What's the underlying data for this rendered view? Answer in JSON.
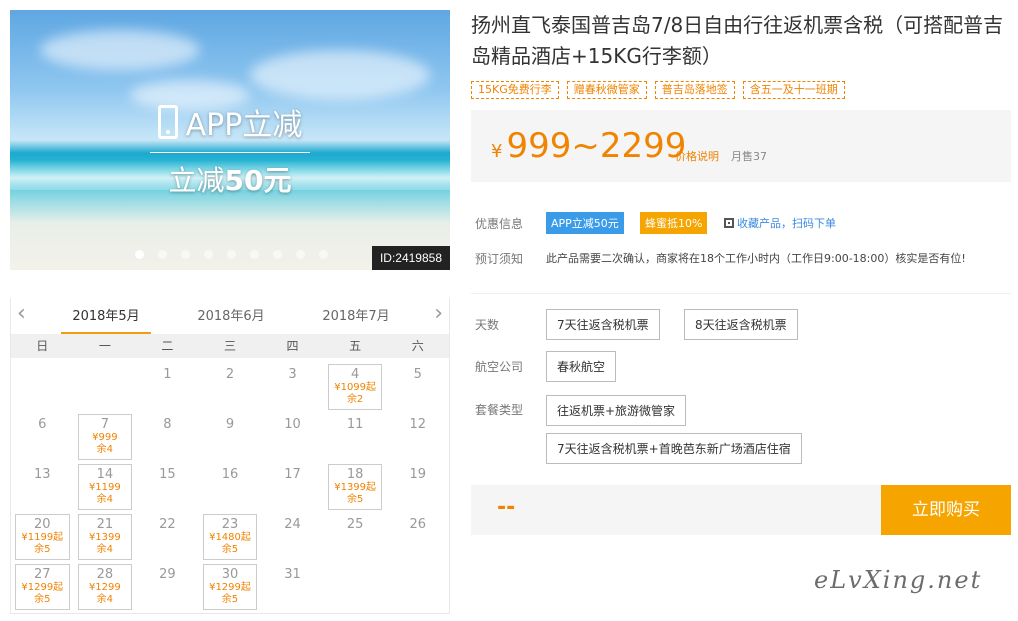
{
  "hero": {
    "promo_line1": "APP立减",
    "promo_line2_prefix": "立减",
    "promo_line2_amount": "50元",
    "image_id": "ID:2419858",
    "slides": 9,
    "active_slide": 0
  },
  "calendar": {
    "months": [
      "2018年5月",
      "2018年6月",
      "2018年7月"
    ],
    "active_month": 0,
    "weekdays": [
      "日",
      "一",
      "二",
      "三",
      "四",
      "五",
      "六"
    ],
    "first_weekday": 2,
    "days_in_month": 31,
    "availability": {
      "4": {
        "price": "¥1099起",
        "stock": "余2"
      },
      "7": {
        "price": "¥999",
        "stock": "余4"
      },
      "14": {
        "price": "¥1199",
        "stock": "余4"
      },
      "18": {
        "price": "¥1399起",
        "stock": "余5"
      },
      "20": {
        "price": "¥1199起",
        "stock": "余5"
      },
      "21": {
        "price": "¥1399",
        "stock": "余4"
      },
      "23": {
        "price": "¥1480起",
        "stock": "余5"
      },
      "27": {
        "price": "¥1299起",
        "stock": "余5"
      },
      "28": {
        "price": "¥1299",
        "stock": "余4"
      },
      "30": {
        "price": "¥1299起",
        "stock": "余5"
      }
    }
  },
  "product": {
    "title": "扬州直飞泰国普吉岛7/8日自由行往返机票含税（可搭配普吉岛精品酒店+15KG行李额）",
    "tags": [
      "15KG免费行李",
      "赠春秋微管家",
      "普吉岛落地签",
      "含五一及十一班期"
    ],
    "price_currency": "¥",
    "price_range": "999~2299",
    "price_note": "价格说明",
    "sold": "月售37"
  },
  "offers": {
    "label": "优惠信息",
    "badge_app": "APP立减50元",
    "badge_bee": "蜂蜜抵10%",
    "fav_link": "收藏产品，扫码下单"
  },
  "notice": {
    "label": "预订须知",
    "text": "此产品需要二次确认，商家将在18个工作小时内（工作日9:00-18:00）核实是否有位!"
  },
  "options": {
    "days_label": "天数",
    "days": [
      "7天往返含税机票",
      "8天往返含税机票"
    ],
    "airline_label": "航空公司",
    "airline": "春秋航空",
    "package_label": "套餐类型",
    "packages": [
      "往返机票+旅游微管家",
      "7天往返含税机票+首晚芭东新广场酒店住宿"
    ]
  },
  "buy": {
    "total": "--",
    "button": "立即购买"
  },
  "watermark": "eLvXing.net",
  "colors": {
    "accent": "#f08300",
    "buy_button": "#f5a400",
    "blue_badge": "#3a9be9"
  }
}
